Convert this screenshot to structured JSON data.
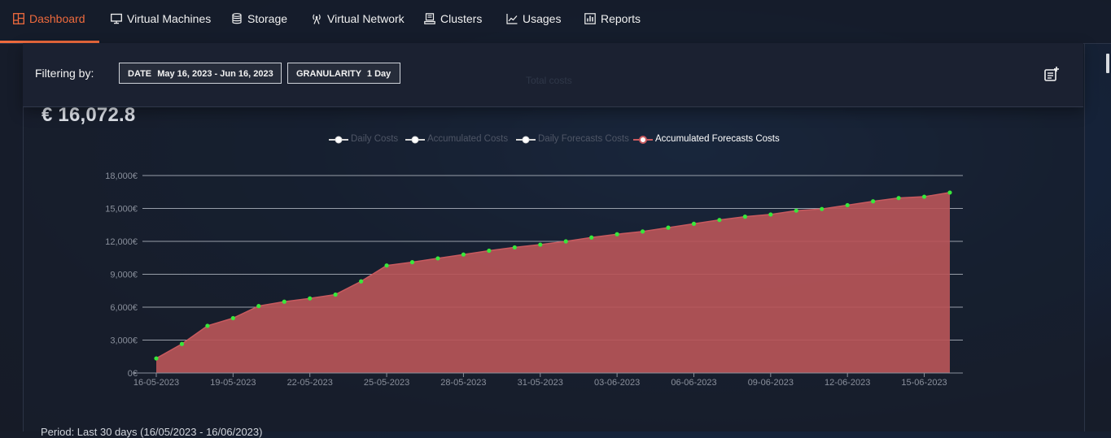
{
  "nav": {
    "items": [
      {
        "label": "Dashboard",
        "icon": "dashboard-icon",
        "active": true
      },
      {
        "label": "Virtual Machines",
        "icon": "monitor-icon"
      },
      {
        "label": "Storage",
        "icon": "database-icon"
      },
      {
        "label": "Virtual Network",
        "icon": "antenna-icon"
      },
      {
        "label": "Clusters",
        "icon": "server-icon"
      },
      {
        "label": "Usages",
        "icon": "line-chart-icon"
      },
      {
        "label": "Reports",
        "icon": "report-icon"
      }
    ],
    "accent_color": "#ee6a3d"
  },
  "filter": {
    "label": "Filtering by:",
    "date_key": "DATE",
    "date_value": "May 16, 2023 - Jun 16, 2023",
    "granularity_key": "GRANULARITY",
    "granularity_value": "1 Day",
    "ghost_title": "Total costs"
  },
  "summary": {
    "total": "€ 16,072.8"
  },
  "legend": [
    {
      "label": "Daily Costs",
      "active": false
    },
    {
      "label": "Accumulated Costs",
      "active": false
    },
    {
      "label": "Daily Forecasts Costs",
      "active": false
    },
    {
      "label": "Accumulated Forecasts Costs",
      "active": true
    }
  ],
  "chart_data": {
    "type": "area",
    "series_name": "Accumulated Forecasts Costs",
    "fill_color": "#b75558",
    "line_color": "#c85a5f",
    "point_color": "#39e73b",
    "ylim": [
      0,
      18000
    ],
    "yticks": [
      0,
      3000,
      6000,
      9000,
      12000,
      15000,
      18000
    ],
    "ytick_labels": [
      "0€",
      "3,000€",
      "6,000€",
      "9,000€",
      "12,000€",
      "15,000€",
      "18,000€"
    ],
    "xtick_labels": [
      "16-05-2023",
      "19-05-2023",
      "22-05-2023",
      "25-05-2023",
      "28-05-2023",
      "31-05-2023",
      "03-06-2023",
      "06-06-2023",
      "09-06-2023",
      "12-06-2023",
      "15-06-2023"
    ],
    "x": [
      "16-05-2023",
      "17-05-2023",
      "18-05-2023",
      "19-05-2023",
      "20-05-2023",
      "21-05-2023",
      "22-05-2023",
      "23-05-2023",
      "24-05-2023",
      "25-05-2023",
      "26-05-2023",
      "27-05-2023",
      "28-05-2023",
      "29-05-2023",
      "30-05-2023",
      "31-05-2023",
      "01-06-2023",
      "02-06-2023",
      "03-06-2023",
      "04-06-2023",
      "05-06-2023",
      "06-06-2023",
      "07-06-2023",
      "08-06-2023",
      "09-06-2023",
      "10-06-2023",
      "11-06-2023",
      "12-06-2023",
      "13-06-2023",
      "14-06-2023",
      "15-06-2023",
      "16-06-2023"
    ],
    "values": [
      1330,
      2650,
      4300,
      5000,
      6100,
      6500,
      6800,
      7150,
      8350,
      9800,
      10100,
      10450,
      10800,
      11150,
      11450,
      11700,
      12000,
      12350,
      12650,
      12900,
      13250,
      13600,
      13950,
      14250,
      14450,
      14800,
      14950,
      15300,
      15650,
      15950,
      16070,
      16450
    ]
  },
  "footer": {
    "text": "Period: Last 30 days (16/05/2023 - 16/06/2023)"
  }
}
